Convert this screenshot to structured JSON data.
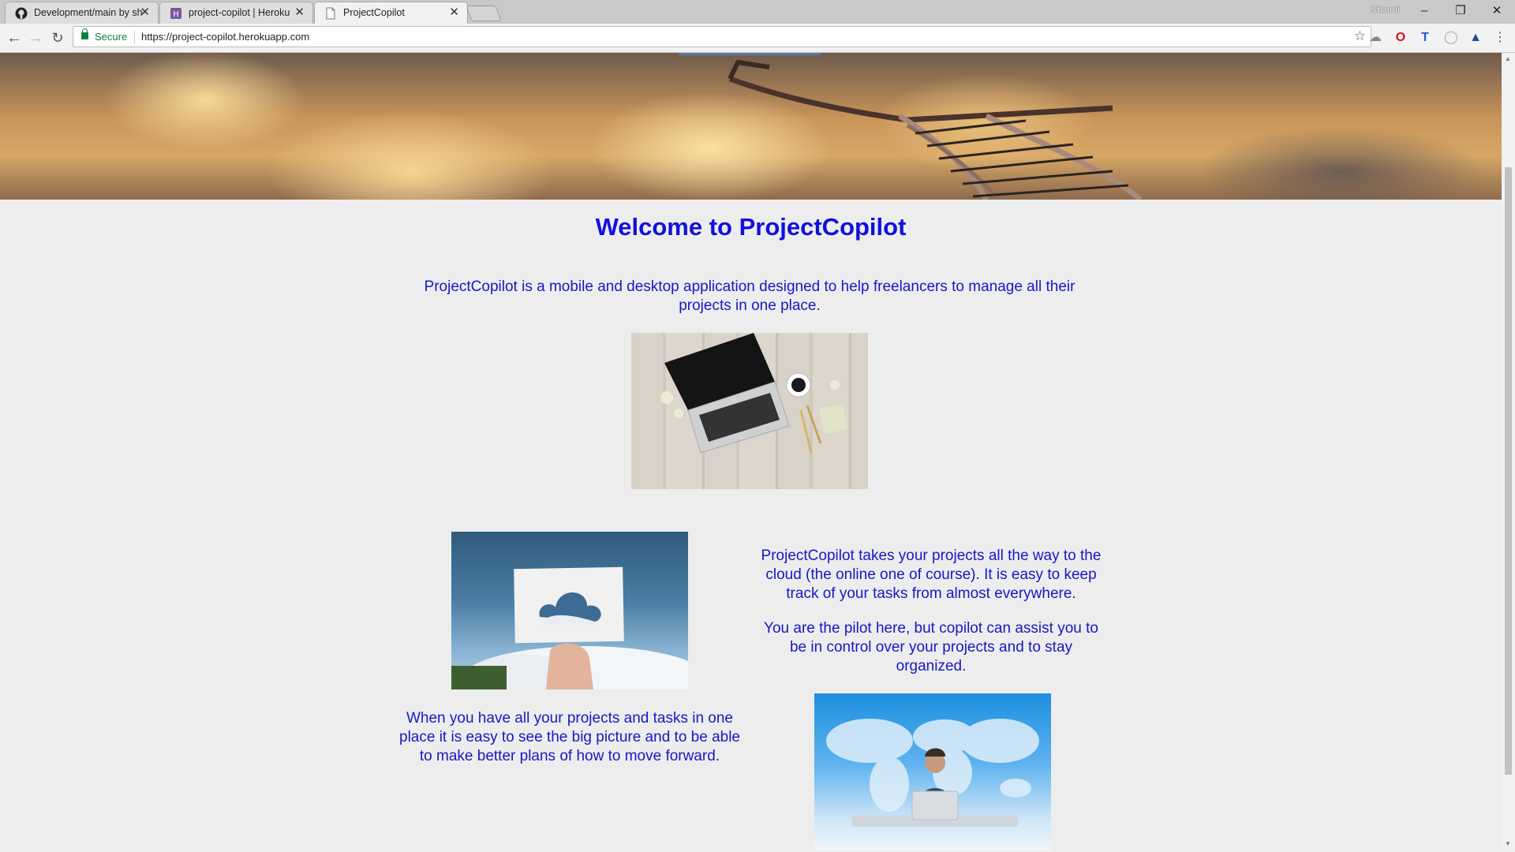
{
  "browser": {
    "tabs": [
      {
        "title": "Development/main by sh",
        "icon": "github-icon"
      },
      {
        "title": "project-copilot | Heroku",
        "icon": "heroku-icon"
      },
      {
        "title": "ProjectCopilot",
        "icon": "document-icon"
      }
    ],
    "profile": "Shlomi",
    "security_label": "Secure",
    "url": "https://project-copilot.herokuapp.com"
  },
  "page": {
    "title": "Welcome to ProjectCopilot",
    "intro": "ProjectCopilot is a mobile and desktop application designed to help freelancers to manage all their projects in one place.",
    "cloud_text": "ProjectCopilot takes your projects all the way to the cloud (the online one of course). It is easy to keep track of your tasks from almost everywhere.",
    "pilot_text": "You are the pilot here, but copilot can assist you to be in control over your projects and to stay organized.",
    "big_picture_text": "When you have all your projects and tasks in one place it is easy to see the big picture and to be able to make better plans of how to move forward.",
    "text_color": "#1717c8",
    "title_color": "#1010e0"
  }
}
